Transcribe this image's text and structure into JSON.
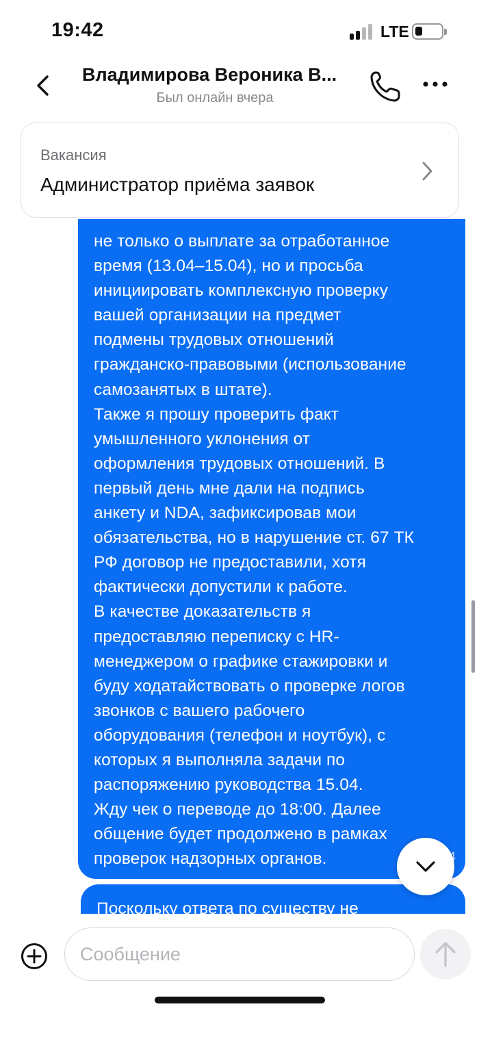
{
  "status_bar": {
    "time": "19:42",
    "network": "LTE",
    "signal_bars_filled": 2,
    "signal_bars_total": 4
  },
  "header": {
    "title": "Владимирова Вероника В...",
    "subtitle": "Был онлайн вчера",
    "back_icon": "chevron-left-icon",
    "call_icon": "phone-icon",
    "more_icon": "more-horizontal-icon"
  },
  "vacancy": {
    "label": "Вакансия",
    "title": "Администратор приёма заявок",
    "chevron_icon": "chevron-right-icon"
  },
  "messages": [
    {
      "direction": "outgoing",
      "text": "не только о выплате за отработанное\nвремя (13.04–15.04), но и просьба\nинициировать комплексную проверку\nвашей организации на предмет\nподмены трудовых отношений\nгражданско-правовыми (использование\nсамозанятых в штате).\nТакже я прошу проверить факт\nумышленного уклонения от\nоформления трудовых отношений. В\nпервый день мне дали на подпись\nанкету и NDA, зафиксировав мои\nобязательства, но в нарушение ст. 67 ТК\nРФ договор не предоставили, хотя\nфактически допустили к работе.\nВ качестве доказательств я\nпредоставляю переписку с HR-\nменеджером о графике стажировки и\nбуду ходатайствовать о проверке логов\nзвонков с вашего рабочего\nоборудования (телефон и ноутбук), с\nкоторых я выполняла задачи по\nраспоряжению руководства 15.04.\nЖду чек о переводе до 18:00. Далее\nобщение будет продолжено в рамках\nпроверок надзорных органов.",
      "time": "19:4"
    },
    {
      "direction": "outgoing",
      "text": "Поскольку ответа по существу не"
    }
  ],
  "composer": {
    "placeholder": "Сообщение",
    "value": "",
    "add_icon": "plus-circle-icon",
    "send_icon": "arrow-up-icon"
  },
  "colors": {
    "bubble": "#0a6ef5",
    "accent": "#0a6ef5",
    "muted_text": "#8a8a8e"
  }
}
